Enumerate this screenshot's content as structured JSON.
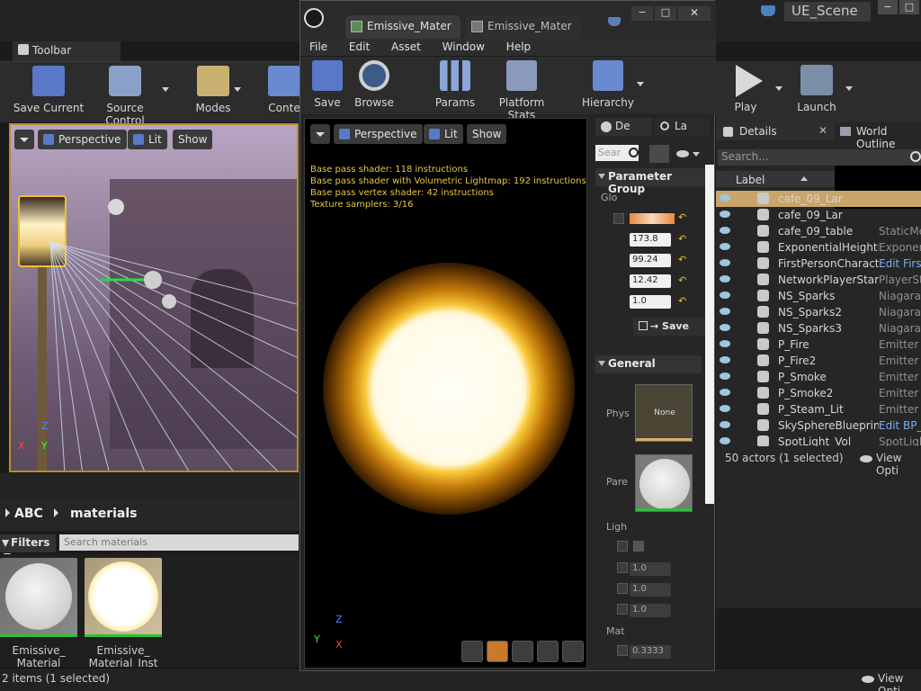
{
  "main": {
    "scene_tab": "UE_Scene",
    "toolbar_tab": "Toolbar",
    "ribbon": [
      "Save Current",
      "Source Control",
      "Modes",
      "Conte"
    ],
    "ribbon_right": [
      "Play",
      "Launch"
    ],
    "win_buttons": [
      "−",
      "□"
    ]
  },
  "viewport": {
    "perspective": "Perspective",
    "lit": "Lit",
    "show": "Show",
    "axis": {
      "x": "X",
      "y": "Y",
      "z": "Z"
    }
  },
  "content_browser": {
    "path": [
      "ABC",
      "materials"
    ],
    "filters": "Filters",
    "search_placeholder": "Search materials",
    "assets": [
      {
        "line1": "Emissive_",
        "line2": "Material"
      },
      {
        "line1": "Emissive_",
        "line2": "Material_Inst"
      }
    ],
    "status": "2 items (1 selected)",
    "view_options": "View Opti"
  },
  "material_editor": {
    "tabs": [
      "Emissive_Mater",
      "Emissive_Mater"
    ],
    "win_buttons": [
      "−",
      "□",
      "✕"
    ],
    "menu": [
      "File",
      "Edit",
      "Asset",
      "Window",
      "Help"
    ],
    "toolbar": [
      "Save",
      "Browse",
      "Params",
      "Platform Stats",
      "Hierarchy"
    ],
    "viewport": {
      "perspective": "Perspective",
      "lit": "Lit",
      "show": "Show",
      "stats": [
        "Base pass shader: 118 instructions",
        "Base pass shader with Volumetric Lightmap: 192 instructions",
        "Base pass vertex shader: 42 instructions",
        "Texture samplers: 3/16"
      ],
      "axis": {
        "x": "X",
        "y": "Y",
        "z": "Z"
      }
    },
    "details": {
      "tabs": [
        "De",
        "La"
      ],
      "search_placeholder": "Sear",
      "param_group": "Parameter Group",
      "glob_label": "Glo",
      "values": [
        "173.8",
        "99.24",
        "12.42",
        "1.0"
      ],
      "save_label": "Save",
      "general": "General",
      "phys_label": "Phys",
      "phys_value": "None",
      "pare_label": "Pare",
      "ligh_label": "Ligh",
      "ligh_values": [
        "1.0",
        "1.0",
        "1.0"
      ],
      "mat_label": "Mat",
      "mat_value": "0.3333"
    }
  },
  "world_outliner": {
    "tabs": [
      "Details",
      "World Outline"
    ],
    "search_placeholder": "Search...",
    "label_header": "Label",
    "rows": [
      {
        "name": "cafe_09_Lar",
        "type": ""
      },
      {
        "name": "cafe_09_Lar",
        "type": ""
      },
      {
        "name": "cafe_09_table",
        "type": "StaticMe"
      },
      {
        "name": "ExponentialHeightFo",
        "type": "Exponent"
      },
      {
        "name": "FirstPersonCharacter",
        "type": "Edit Firs",
        "link": true
      },
      {
        "name": "NetworkPlayerStart",
        "type": "PlayerSta"
      },
      {
        "name": "NS_Sparks",
        "type": "NiagaraA"
      },
      {
        "name": "NS_Sparks2",
        "type": "NiagaraA"
      },
      {
        "name": "NS_Sparks3",
        "type": "NiagaraA"
      },
      {
        "name": "P_Fire",
        "type": "Emitter"
      },
      {
        "name": "P_Fire2",
        "type": "Emitter"
      },
      {
        "name": "P_Smoke",
        "type": "Emitter"
      },
      {
        "name": "P_Smoke2",
        "type": "Emitter"
      },
      {
        "name": "P_Steam_Lit",
        "type": "Emitter"
      },
      {
        "name": "SkySphereBlueprint",
        "type": "Edit BP_",
        "link": true
      },
      {
        "name": "SpotLight_Vol",
        "type": "SpotLigh"
      }
    ],
    "status": "50 actors (1 selected)",
    "view_options": "View Opti"
  },
  "colors": {
    "accent_orange": "#b78f2a",
    "stats_yellow": "#e8c840",
    "link_blue": "#77aef0"
  }
}
